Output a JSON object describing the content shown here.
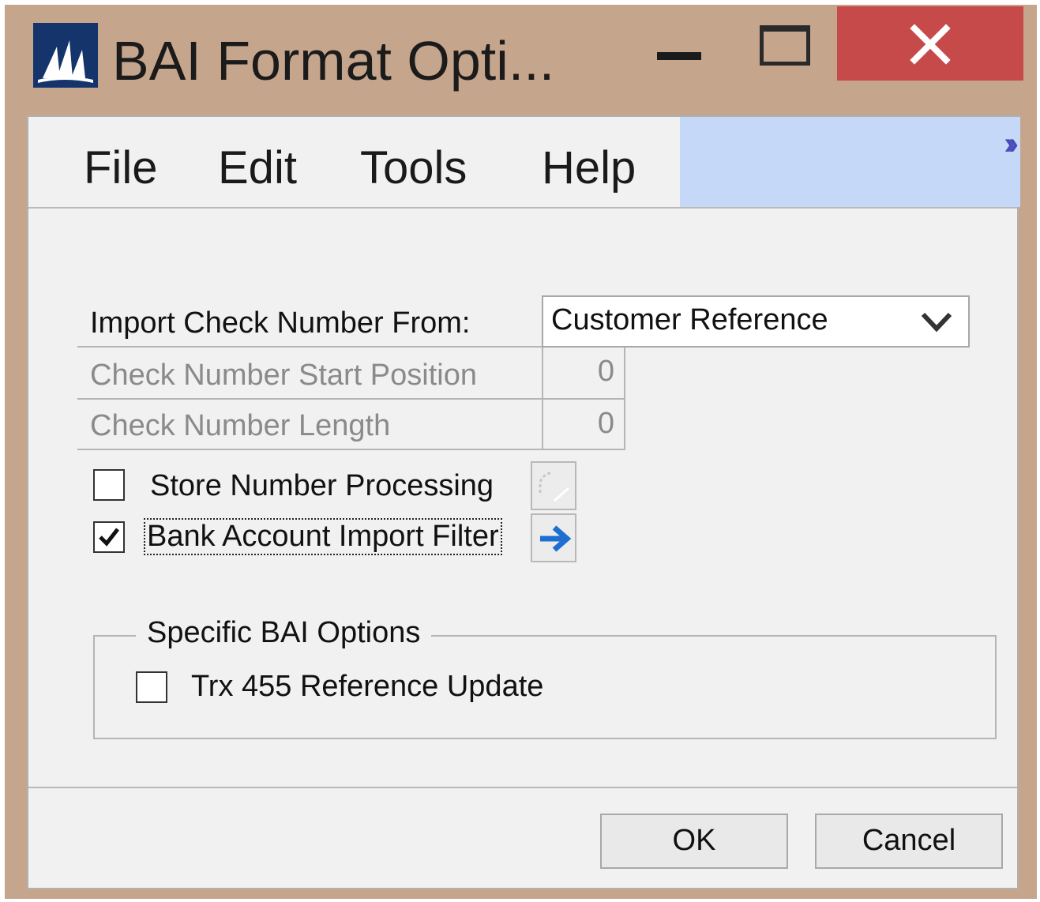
{
  "window": {
    "title": "BAI Format Opti...",
    "logo_icon": "dynamics-sail-logo-icon",
    "controls": {
      "minimize_icon": "minimize-icon",
      "maximize_icon": "maximize-icon",
      "close_icon": "close-icon",
      "close_color": "#c74a4a"
    }
  },
  "menu": {
    "items": [
      "File",
      "Edit",
      "Tools",
      "Help"
    ],
    "overflow_icon": "chevron-double-right-icon",
    "highlight_color": "#c5d8f7"
  },
  "form": {
    "import_check_number_from": {
      "label": "Import Check Number From:",
      "value": "Customer Reference"
    },
    "check_number_start_position": {
      "label": "Check Number Start Position",
      "value": "0"
    },
    "check_number_length": {
      "label": "Check Number Length",
      "value": "0"
    },
    "store_number_processing": {
      "label": "Store Number Processing",
      "checked": false
    },
    "bank_account_import_filter": {
      "label": "Bank Account Import Filter",
      "checked": true
    }
  },
  "specific_bai_options": {
    "title": "Specific BAI Options",
    "trx_455": {
      "label": "Trx 455 Reference Update",
      "checked": false
    }
  },
  "buttons": {
    "ok": "OK",
    "cancel": "Cancel"
  }
}
